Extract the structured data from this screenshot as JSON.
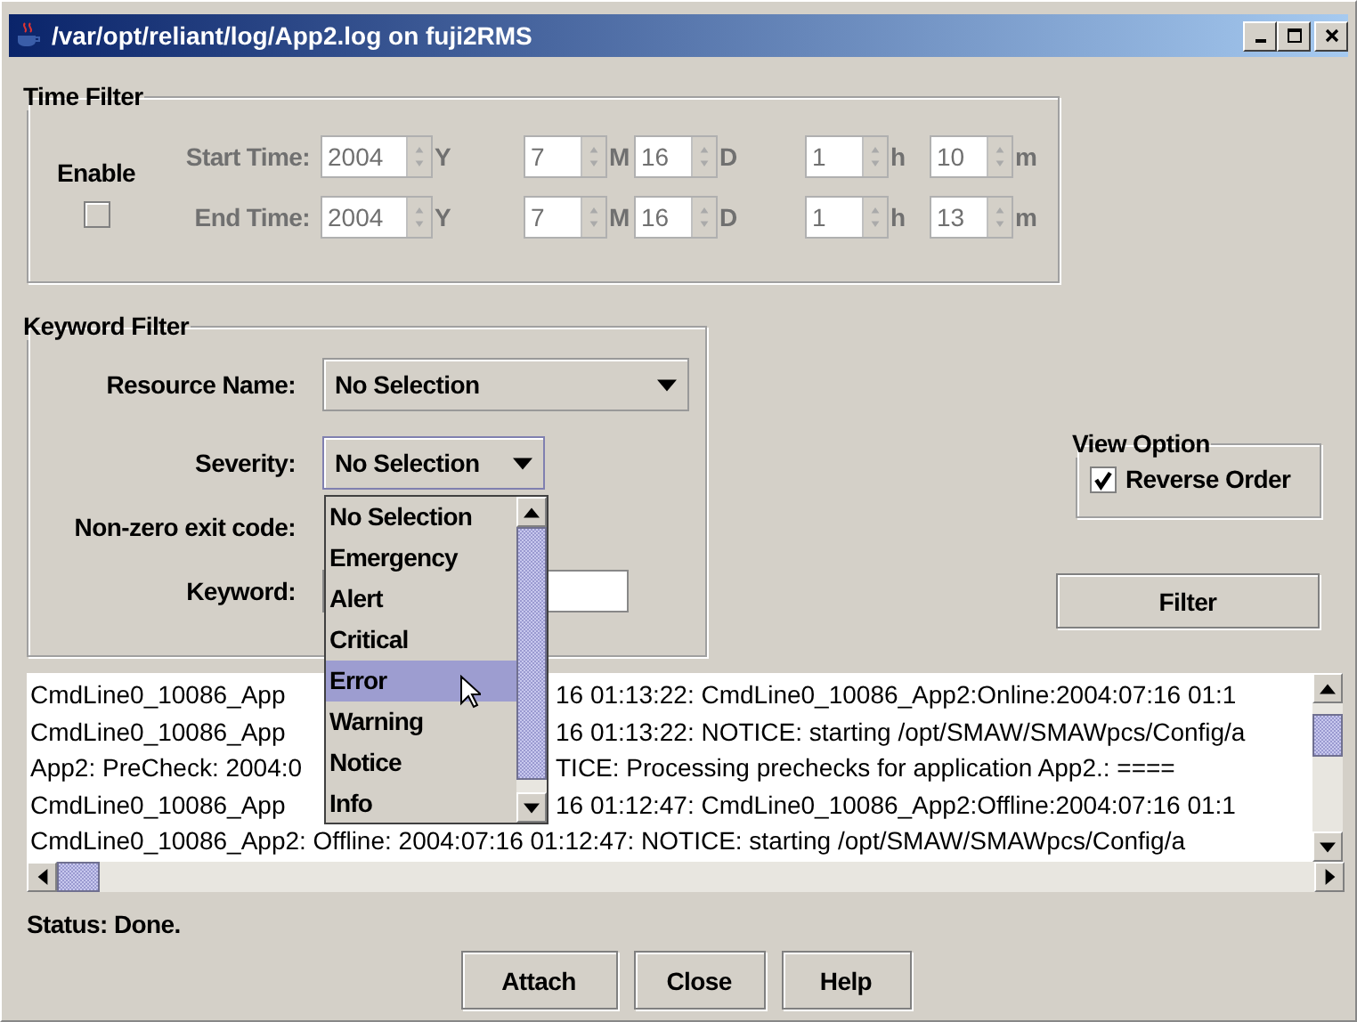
{
  "window": {
    "title": "/var/opt/reliant/log/App2.log on fuji2RMS"
  },
  "time_filter": {
    "title": "Time Filter",
    "enable_label": "Enable",
    "enabled": false,
    "rows": [
      {
        "label": "Start Time:",
        "fields": [
          {
            "value": "2004",
            "unit": "Y"
          },
          {
            "value": "7",
            "unit": "M"
          },
          {
            "value": "16",
            "unit": "D"
          },
          {
            "value": "1",
            "unit": "h"
          },
          {
            "value": "10",
            "unit": "m"
          }
        ]
      },
      {
        "label": "End Time:",
        "fields": [
          {
            "value": "2004",
            "unit": "Y"
          },
          {
            "value": "7",
            "unit": "M"
          },
          {
            "value": "16",
            "unit": "D"
          },
          {
            "value": "1",
            "unit": "h"
          },
          {
            "value": "13",
            "unit": "m"
          }
        ]
      }
    ]
  },
  "keyword_filter": {
    "title": "Keyword Filter",
    "resource_name": {
      "label": "Resource Name:",
      "value": "No Selection"
    },
    "severity": {
      "label": "Severity:",
      "value": "No Selection"
    },
    "nonzero_exit_code": {
      "label": "Non-zero exit code:"
    },
    "keyword": {
      "label": "Keyword:"
    }
  },
  "severity_options": [
    {
      "label": "No Selection",
      "selected": false
    },
    {
      "label": "Emergency",
      "selected": false
    },
    {
      "label": "Alert",
      "selected": false
    },
    {
      "label": "Critical",
      "selected": false
    },
    {
      "label": "Error",
      "selected": true
    },
    {
      "label": "Warning",
      "selected": false
    },
    {
      "label": "Notice",
      "selected": false
    },
    {
      "label": "Info",
      "selected": false
    }
  ],
  "view_option": {
    "title": "View Option",
    "reverse_order": {
      "label": "Reverse Order",
      "checked": true
    }
  },
  "filter_button": "Filter",
  "log_lines": [
    {
      "left": "CmdLine0_10086_App",
      "right": "16 01:13:22: CmdLine0_10086_App2:Online:2004:07:16 01:1"
    },
    {
      "left": "CmdLine0_10086_App",
      "right": "16 01:13:22: NOTICE: starting /opt/SMAW/SMAWpcs/Config/a"
    },
    {
      "left": "App2: PreCheck: 2004:0",
      "right": "TICE: Processing prechecks for application App2.: ===="
    },
    {
      "left": "CmdLine0_10086_App",
      "right": "16 01:12:47: CmdLine0_10086_App2:Offline:2004:07:16 01:1"
    },
    {
      "left": "CmdLine0_10086_App2: Offline: 2004:07:16 01:12:47: NOTICE: starting /opt/SMAW/SMAWpcs/Config/a"
    }
  ],
  "status": "Status: Done.",
  "buttons": [
    "Attach",
    "Close",
    "Help"
  ]
}
